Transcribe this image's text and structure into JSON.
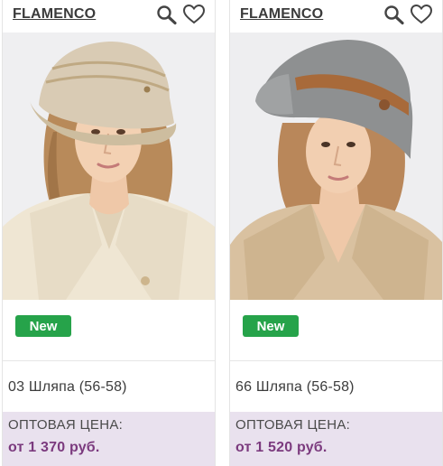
{
  "products": [
    {
      "brand": "FLAMENCO",
      "badge": "New",
      "title": "03 Шляпа (56-58)",
      "price_label": "ОПТОВАЯ ЦЕНА:",
      "price": "от 1 370 руб.",
      "hat_color": "#d9cbb4",
      "coat_color": "#efe6d3",
      "icons": [
        "search-icon",
        "heart-icon"
      ]
    },
    {
      "brand": "FLAMENCO",
      "badge": "New",
      "title": "66 Шляпа (56-58)",
      "price_label": "ОПТОВАЯ ЦЕНА:",
      "price": "от 1 520 руб.",
      "hat_color": "#8e9091",
      "coat_color": "#d9c1a0",
      "icons": [
        "search-icon",
        "heart-icon"
      ]
    }
  ],
  "colors": {
    "badge_green": "#26a34a",
    "price_bg": "#e9e1ee",
    "price_text": "#7b3a7e"
  }
}
